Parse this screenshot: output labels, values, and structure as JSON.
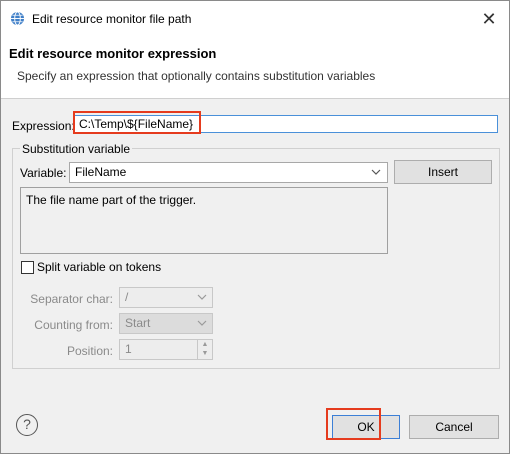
{
  "window": {
    "title": "Edit resource monitor file path",
    "close_glyph": "✕"
  },
  "header": {
    "title": "Edit resource monitor expression",
    "description": "Specify an expression that optionally contains substitution variables"
  },
  "expression": {
    "label": "Expression:",
    "value": "C:\\Temp\\${FileName}"
  },
  "substitution": {
    "group_label": "Substitution variable",
    "variable_label": "Variable:",
    "variable_value": "FileName",
    "insert_label": "Insert",
    "description": "The file name part of the trigger."
  },
  "split": {
    "checkbox_label": "Split variable on tokens",
    "checked": false,
    "separator_label": "Separator char:",
    "separator_value": "/",
    "counting_label": "Counting from:",
    "counting_value": "Start",
    "position_label": "Position:",
    "position_value": "1"
  },
  "footer": {
    "help_glyph": "?",
    "ok_label": "OK",
    "cancel_label": "Cancel"
  },
  "colors": {
    "highlight": "#e53b1e",
    "focus": "#4a90d9",
    "dialog_bg": "#f0f0f0"
  },
  "icons": [
    "globe-icon",
    "close-icon",
    "chevron-down-icon",
    "spin-up-icon",
    "spin-down-icon",
    "help-icon"
  ]
}
